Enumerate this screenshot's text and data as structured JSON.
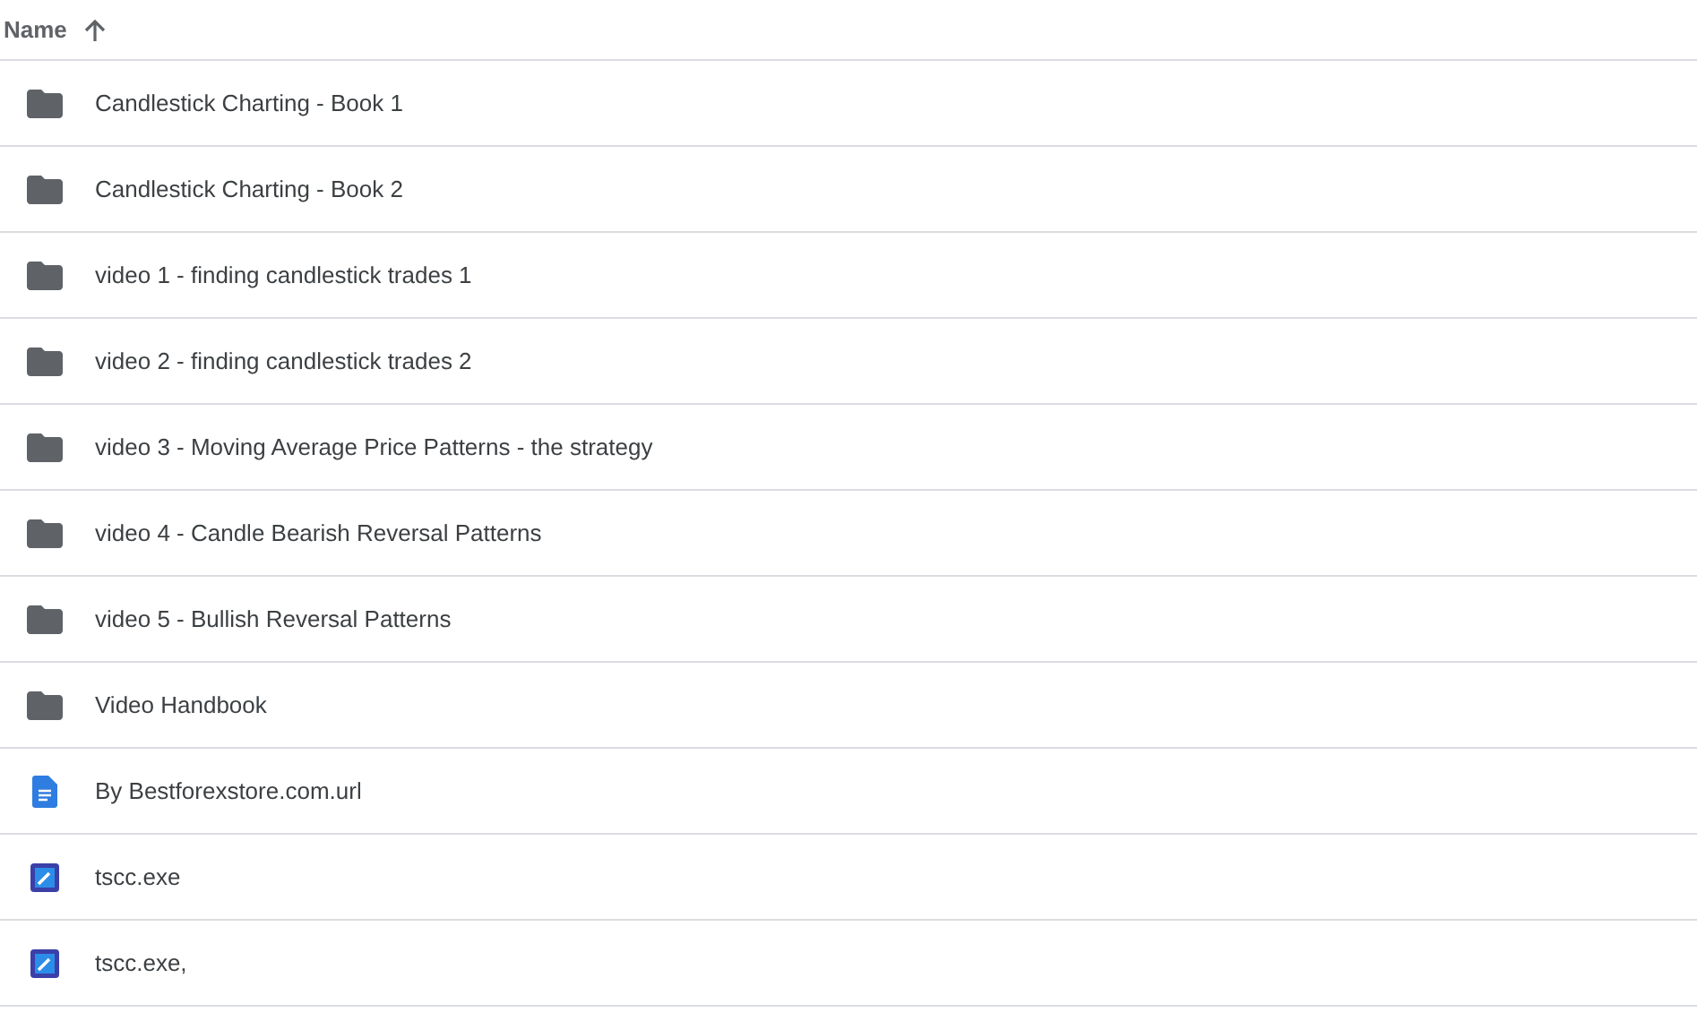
{
  "header": {
    "label": "Name",
    "ascending": true
  },
  "files": [
    {
      "kind": "folder",
      "name": "Candlestick Charting - Book 1"
    },
    {
      "kind": "folder",
      "name": "Candlestick Charting - Book 2"
    },
    {
      "kind": "folder",
      "name": "video 1 - finding candlestick trades 1"
    },
    {
      "kind": "folder",
      "name": "video 2 - finding candlestick trades 2"
    },
    {
      "kind": "folder",
      "name": "video 3 - Moving Average Price Patterns - the strategy"
    },
    {
      "kind": "folder",
      "name": "video 4 - Candle Bearish Reversal Patterns"
    },
    {
      "kind": "folder",
      "name": "video 5 - Bullish Reversal Patterns"
    },
    {
      "kind": "folder",
      "name": "Video Handbook"
    },
    {
      "kind": "document",
      "name": "By Bestforexstore.com.url"
    },
    {
      "kind": "program",
      "name": "tscc.exe"
    },
    {
      "kind": "program",
      "name": "tscc.exe,"
    }
  ]
}
